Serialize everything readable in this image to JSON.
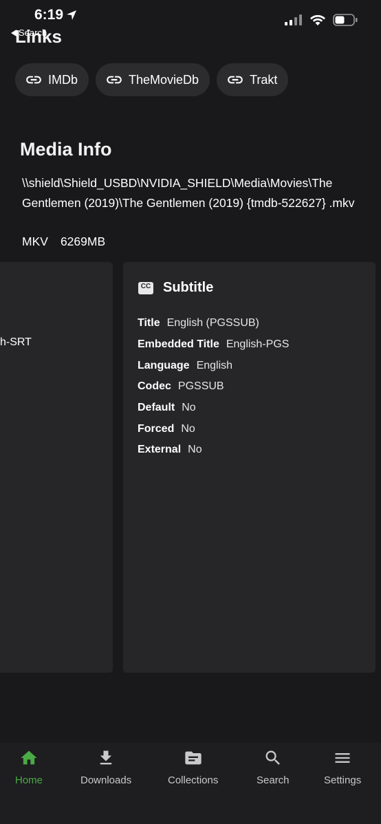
{
  "status_bar": {
    "time": "6:19"
  },
  "nav": {
    "back_label": "Search",
    "title": "Links"
  },
  "links": [
    {
      "label": "IMDb"
    },
    {
      "label": "TheMovieDb"
    },
    {
      "label": "Trakt"
    }
  ],
  "media_info": {
    "title": "Media Info",
    "path": "\\\\shield\\Shield_USBD\\NVIDIA_SHIELD\\Media\\Movies\\The Gentlemen (2019)\\The Gentlemen (2019) {tmdb-522627} .mkv",
    "container": "MKV",
    "size": "6269MB"
  },
  "left_card": {
    "clipped_text": "h-SRT"
  },
  "subtitle_card": {
    "title": "Subtitle",
    "rows": [
      {
        "key": "Title",
        "value": "English (PGSSUB)"
      },
      {
        "key": "Embedded Title",
        "value": "English-PGS"
      },
      {
        "key": "Language",
        "value": "English"
      },
      {
        "key": "Codec",
        "value": "PGSSUB"
      },
      {
        "key": "Default",
        "value": "No"
      },
      {
        "key": "Forced",
        "value": "No"
      },
      {
        "key": "External",
        "value": "No"
      }
    ]
  },
  "tabbar": {
    "items": [
      {
        "label": "Home",
        "icon": "home-icon",
        "active": true
      },
      {
        "label": "Downloads",
        "icon": "download-icon",
        "active": false
      },
      {
        "label": "Collections",
        "icon": "folder-icon",
        "active": false
      },
      {
        "label": "Search",
        "icon": "search-icon",
        "active": false
      },
      {
        "label": "Settings",
        "icon": "menu-icon",
        "active": false
      }
    ],
    "active_color": "#4aaa45",
    "inactive_color": "#c9c9c9"
  }
}
